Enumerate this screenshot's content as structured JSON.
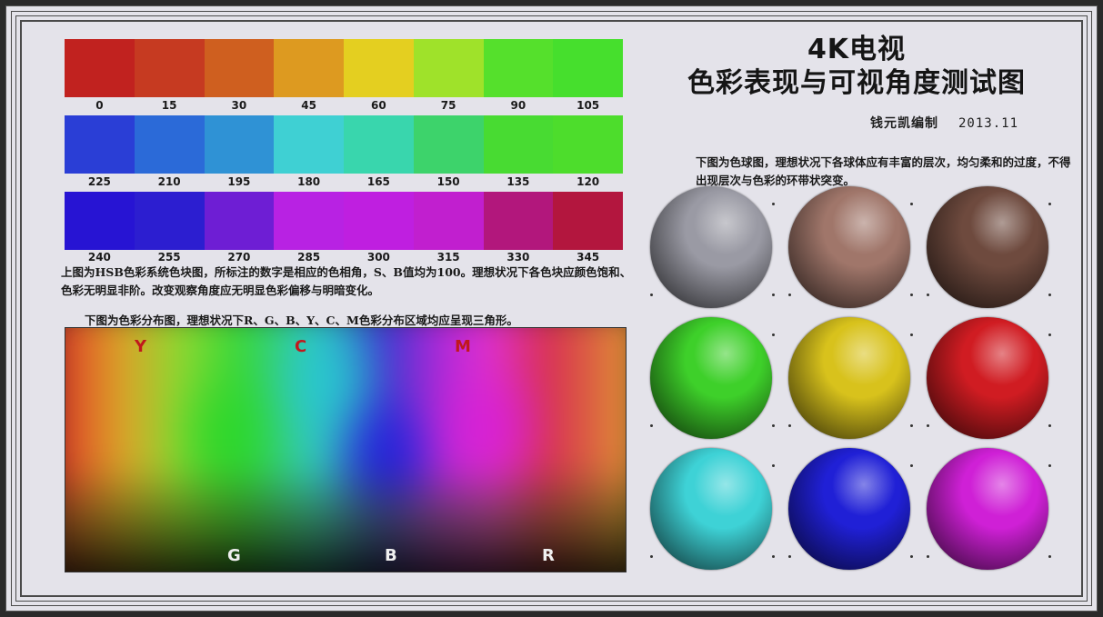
{
  "title": {
    "line1": "4K电视",
    "line2": "色彩表现与可视角度测试图"
  },
  "credit": {
    "author": "钱元凯编制",
    "date": "2013.11"
  },
  "hue_rows": [
    {
      "swatches": [
        "#c1221f",
        "#c63a21",
        "#cf5f1f",
        "#dd9a20",
        "#e4cf20",
        "#9fe22a",
        "#55e02c",
        "#46df2d"
      ],
      "labels": [
        "0",
        "15",
        "30",
        "45",
        "60",
        "75",
        "90",
        "105"
      ]
    },
    {
      "swatches": [
        "#2a3ed6",
        "#2b6ad8",
        "#2f92d5",
        "#3fd0d3",
        "#39d6ad",
        "#3dd36b",
        "#48db32",
        "#4ddd2c"
      ],
      "labels": [
        "225",
        "210",
        "195",
        "180",
        "165",
        "150",
        "135",
        "120"
      ]
    },
    {
      "swatches": [
        "#2714d3",
        "#2c1ed0",
        "#6e1ed4",
        "#b822e3",
        "#bf1fe0",
        "#c11fcf",
        "#b2177c",
        "#b3163e"
      ],
      "labels": [
        "240",
        "255",
        "270",
        "285",
        "300",
        "315",
        "330",
        "345"
      ]
    }
  ],
  "hsb_description": "上图为HSB色彩系统色块图，所标注的数字是相应的色相角，S、B值均为100。理想状况下各色块应颜色饱和、色彩无明显非阶。改变观察角度应无明显色彩偏移与明暗变化。",
  "distribution_title": "下图为色彩分布图，理想状况下R、G、B、Y、C、M色彩分布区域均应呈现三角形。",
  "distribution_labels": {
    "top": [
      "Y",
      "C",
      "M"
    ],
    "bottom": [
      "G",
      "B",
      "R"
    ],
    "top_color": "#c0181c",
    "bottom_color": "#f0f0f0"
  },
  "sphere_description": "下图为色球图，理想状况下各球体应有丰富的层次，均匀柔和的过度，不得出现层次与色彩的环带状突变。",
  "spheres": [
    {
      "name": "gray",
      "color": "#9a9aa4"
    },
    {
      "name": "skin",
      "color": "#a0766a"
    },
    {
      "name": "brown",
      "color": "#6e4a3e"
    },
    {
      "name": "green",
      "color": "#3ed02a"
    },
    {
      "name": "yellow",
      "color": "#d8c21c"
    },
    {
      "name": "red",
      "color": "#d01c22"
    },
    {
      "name": "cyan",
      "color": "#3ed2d6"
    },
    {
      "name": "blue",
      "color": "#2020d6"
    },
    {
      "name": "magenta",
      "color": "#cf20d6"
    }
  ]
}
